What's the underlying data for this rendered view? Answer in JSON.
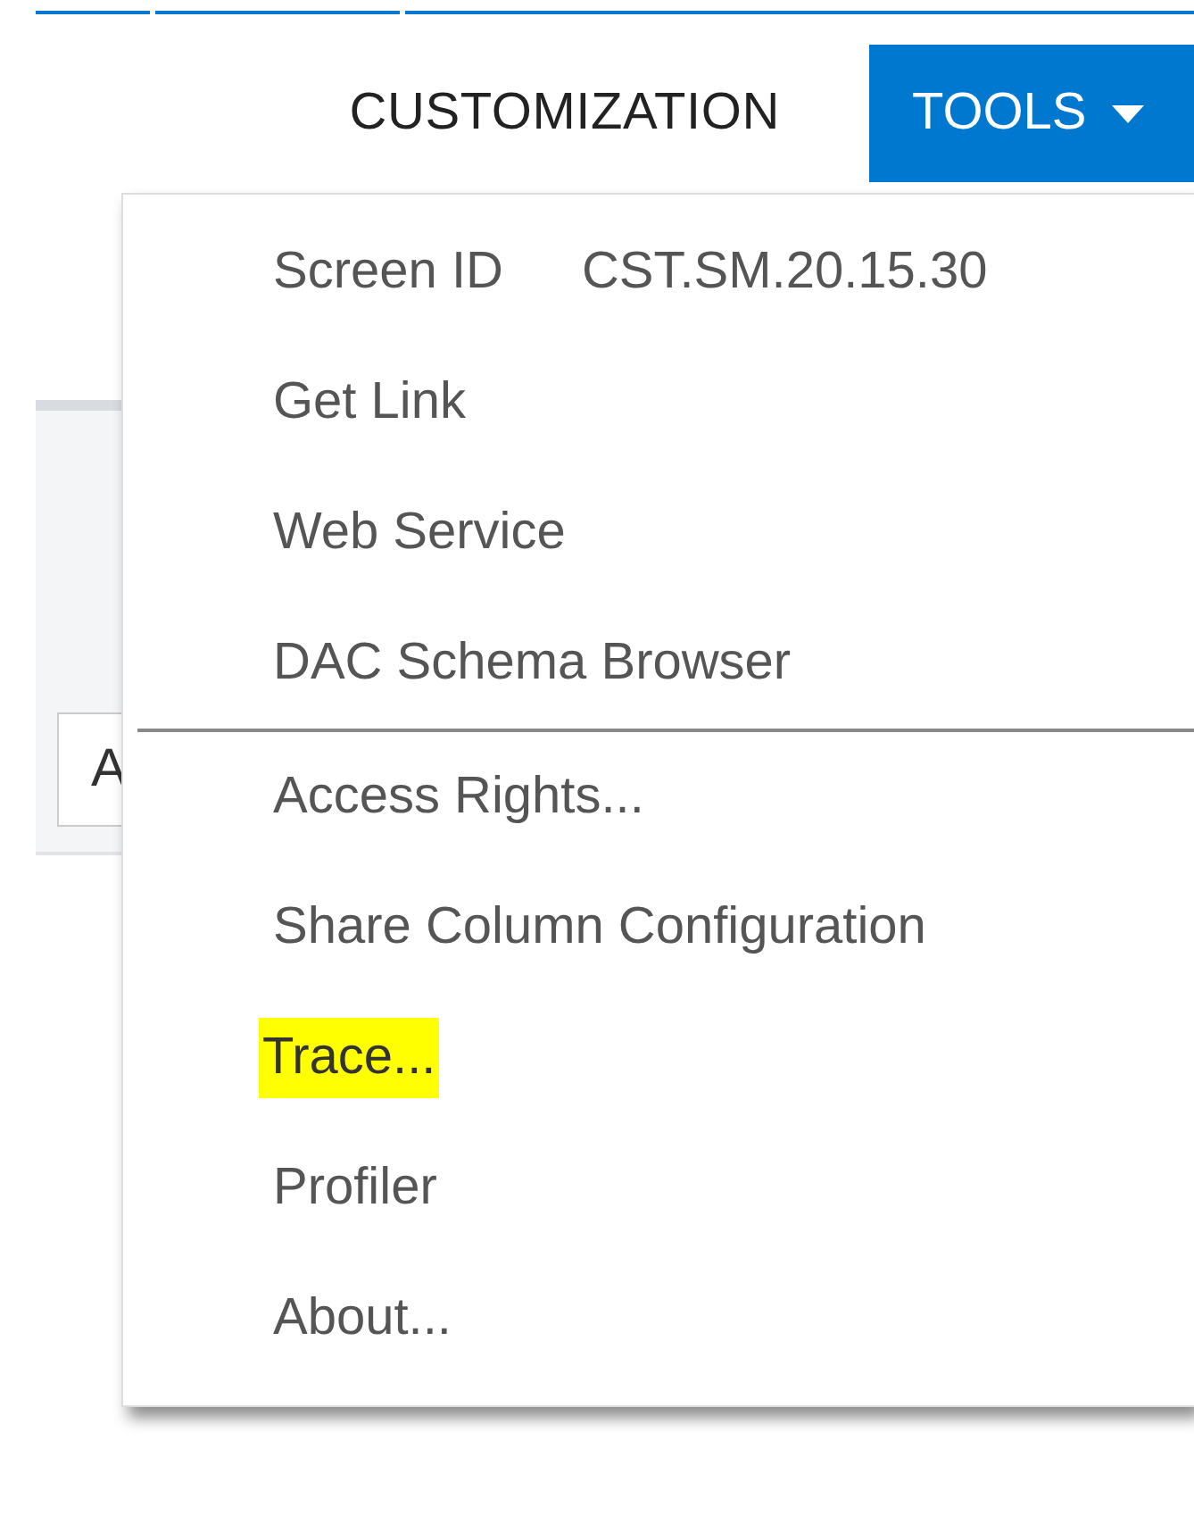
{
  "toolbar": {
    "customization_link": "CUSTOMIZATION",
    "tools_button": {
      "label": "TOOLS",
      "expanded": true
    }
  },
  "background_field": {
    "value": "A"
  },
  "menu": {
    "items": [
      {
        "kind": "info",
        "label": "Screen ID",
        "value": "CST.SM.20.15.30",
        "highlighted": false
      },
      {
        "kind": "item",
        "label": "Get Link",
        "highlighted": false
      },
      {
        "kind": "item",
        "label": "Web Service",
        "highlighted": false
      },
      {
        "kind": "item",
        "label": "DAC Schema Browser",
        "highlighted": false
      },
      {
        "kind": "divider"
      },
      {
        "kind": "item",
        "label": "Access Rights...",
        "highlighted": false
      },
      {
        "kind": "item",
        "label": "Share Column Configuration",
        "highlighted": false
      },
      {
        "kind": "item",
        "label": "Trace...",
        "highlighted": true
      },
      {
        "kind": "item",
        "label": "Profiler",
        "highlighted": false
      },
      {
        "kind": "item",
        "label": "About...",
        "highlighted": false
      }
    ]
  }
}
